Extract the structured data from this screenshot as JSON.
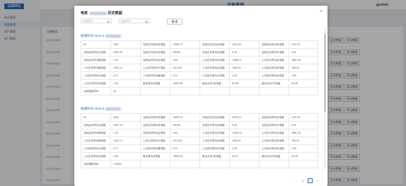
{
  "background": {
    "title": "设备管理",
    "user": "guoww",
    "logo": "GXRTU",
    "menu": [
      "站点管理",
      "设备管理",
      "用户管理",
      "部门管理"
    ],
    "active_menu_index": 1,
    "table_header": "设备编号",
    "row_ids": [
      "201910080",
      "201910080",
      "201910080",
      "201910080",
      "201910080",
      "201910080",
      "201910080",
      "201910080",
      "201910080",
      "201910080",
      "201910080",
      "201910080",
      "201910080"
    ],
    "btn_history": "历史数据",
    "btn_export": "导出数据"
  },
  "modal": {
    "title_prefix": "电表",
    "title_suffix": "历史数据",
    "start_placeholder": "开始时间",
    "end_placeholder": "结束时间",
    "search_label": "搜 索",
    "close_glyph": "×",
    "records": [
      {
        "time_label": "接收时间 2024-0",
        "rows": [
          [
            "ID",
            "1307",
            "当前正向有功总电能",
            "-4098.72",
            "当前正向无功总电能",
            "1002.94",
            "当前反向有功总电能",
            "1211.79"
          ],
          [
            "当前反向有功尖电能",
            "1963.40",
            "当前正向有功总电能",
            "105.56",
            "当前正向有功谷电能",
            "5.18",
            "当前正向有功平电能",
            "0.02"
          ],
          [
            "当前反向有功峰电能",
            "1.29",
            "当前反向有功谷电能",
            "1.89",
            "上月正向有功总电能",
            "-4098.71",
            "上月正向有功尖电能",
            "4561.36"
          ],
          [
            "上月正向有功峰电能",
            "1301.14",
            "上月正向有功平电能",
            "1213.56",
            "上月正向有功谷电能",
            "1964.01",
            "上月反向有功总电能",
            "105.34"
          ],
          [
            "上月反向有功尖电能",
            "5.17",
            "上月反向有功峰电能",
            "0.02",
            "上月反向有功平电能",
            "1.29",
            "上月反向有功谷电能",
            "1.89"
          ],
          [
            "上月正向有功谷电能",
            "1.96",
            "组合有功总电量",
            "-3693.98",
            "组合无功1总电量",
            "60.36",
            "组合无功2总电量",
            "42.35"
          ],
          [
            "当前通信时间",
            "15",
            "",
            "",
            "",
            "",
            "",
            ""
          ]
        ]
      },
      {
        "time_label": "接收时间 2024-0",
        "rows": [
          [
            "ID",
            "2545",
            "当前正向有功总电能",
            "-4098.24",
            "当前正向无功总电能",
            "1002.12",
            "当前反向有功总电能",
            "1211.09"
          ],
          [
            "当前反向有功尖电能",
            "1967.44",
            "当前正向有功总电能",
            "105.56",
            "当前正向有功谷电能",
            "5.18",
            "当前正向有功平电能",
            "0.02"
          ],
          [
            "当前反向有功峰电能",
            "1.29",
            "当前反向有功谷电能",
            "1.89",
            "上月正向有功总电能",
            "-4098.23",
            "上月正向有功尖电能",
            "4561.36"
          ],
          [
            "上月正向有功峰电能",
            "1301.14",
            "上月正向有功平电能",
            "1213.56",
            "上月正向有功谷电能",
            "1964.01",
            "上月反向有功总电能",
            "105.34"
          ],
          [
            "上月反向有功尖电能",
            "5.17",
            "上月反向有功峰电能",
            "0.02",
            "上月反向有功平电能",
            "1.29",
            "上月反向有功谷电能",
            "1.89"
          ],
          [
            "上月正向有功谷电能",
            "1.96",
            "组合有功总电量",
            "-3693.40",
            "组合无功1总电量",
            "60.37",
            "组合无功2总电量",
            "42.46"
          ],
          [
            "当前通信时间",
            "173000",
            "",
            "",
            "",
            "",
            "",
            ""
          ]
        ]
      }
    ],
    "pagination": {
      "prev": "‹",
      "pages": [
        "1",
        "2"
      ],
      "current": "2",
      "next": "›"
    }
  }
}
